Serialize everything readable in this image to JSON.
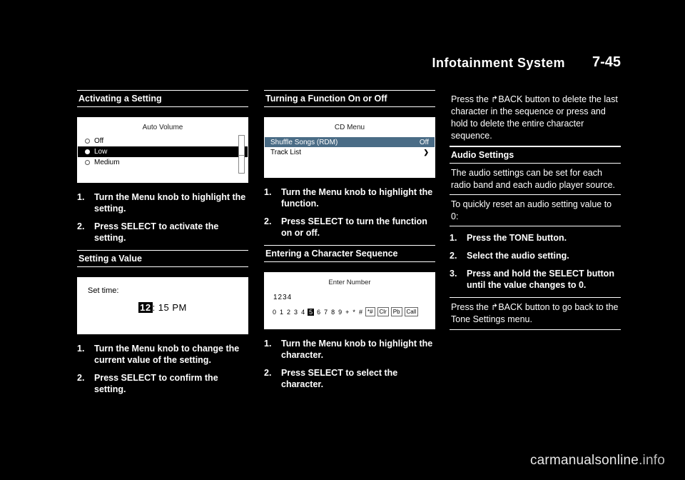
{
  "header": {
    "title": "Infotainment System",
    "page": "7-45"
  },
  "col1": {
    "sections": [
      {
        "heading": "Activating a Setting"
      },
      {
        "heading": "Setting a Value"
      }
    ],
    "screen_auto_volume": {
      "title": "Auto Volume",
      "rows": [
        {
          "label": "Off",
          "selected": false,
          "highlighted": false
        },
        {
          "label": "Low",
          "selected": true,
          "highlighted": true
        },
        {
          "label": "Medium",
          "selected": false,
          "highlighted": false
        }
      ]
    },
    "steps_activate": [
      {
        "num": "1.",
        "text": "Turn the Menu knob to highlight the setting."
      },
      {
        "num": "2.",
        "text": "Press SELECT to activate the setting."
      }
    ],
    "screen_set_time": {
      "label": "Set time:",
      "value_highlighted": "12",
      "value_rest": ": 15 PM"
    },
    "steps_value": [
      {
        "num": "1.",
        "text": "Turn the Menu knob to change the current value of the setting."
      },
      {
        "num": "2.",
        "text": "Press SELECT to confirm the setting."
      }
    ]
  },
  "col2": {
    "sections": [
      {
        "heading": "Turning a Function On or Off"
      },
      {
        "heading": "Entering a Character Sequence"
      }
    ],
    "screen_cd_menu": {
      "title": "CD Menu",
      "rows": [
        {
          "label": "Shuffle Songs (RDM)",
          "value": "Off",
          "selected": true
        },
        {
          "label": "Track List",
          "value": "❯",
          "selected": false
        }
      ]
    },
    "steps_function": [
      {
        "num": "1.",
        "text": "Turn the Menu knob to highlight the function."
      },
      {
        "num": "2.",
        "text": "Press SELECT to turn the function on or off."
      }
    ],
    "screen_enter_number": {
      "title": "Enter Number",
      "entry": "1234",
      "keys": [
        "0",
        "1",
        "2",
        "3",
        "4",
        "5",
        "6",
        "7",
        "8",
        "9",
        "+",
        "*",
        "#"
      ],
      "selected_key": "5",
      "buttons": [
        "*#",
        "Clr",
        "Pb",
        "Call"
      ]
    },
    "steps_character": [
      {
        "num": "1.",
        "text": "Turn the Menu knob to highlight the character."
      },
      {
        "num": "2.",
        "text": "Press SELECT to select the character."
      }
    ]
  },
  "col3": {
    "note_back_delete": {
      "pre": "Press the ",
      "glyph": "↰",
      "post": "BACK button to delete the last character in the sequence or press and hold to delete the entire character sequence."
    },
    "heading_audio": "Audio Settings",
    "text_audio": "The audio settings can be set for each radio band and each audio player source.",
    "text_reset": "To quickly reset an audio setting value to 0:",
    "steps_reset": [
      {
        "num": "1.",
        "text": "Press the TONE button."
      },
      {
        "num": "2.",
        "text": "Select the audio setting."
      },
      {
        "num": "3.",
        "text": "Press and hold the SELECT button until the value changes to 0."
      }
    ],
    "note_back_tone": {
      "pre": "Press the ",
      "glyph": "↰",
      "post": "BACK button to go back to the Tone Settings menu."
    }
  },
  "watermark": {
    "strong": "carmanualsonline",
    "dim": ".info"
  }
}
